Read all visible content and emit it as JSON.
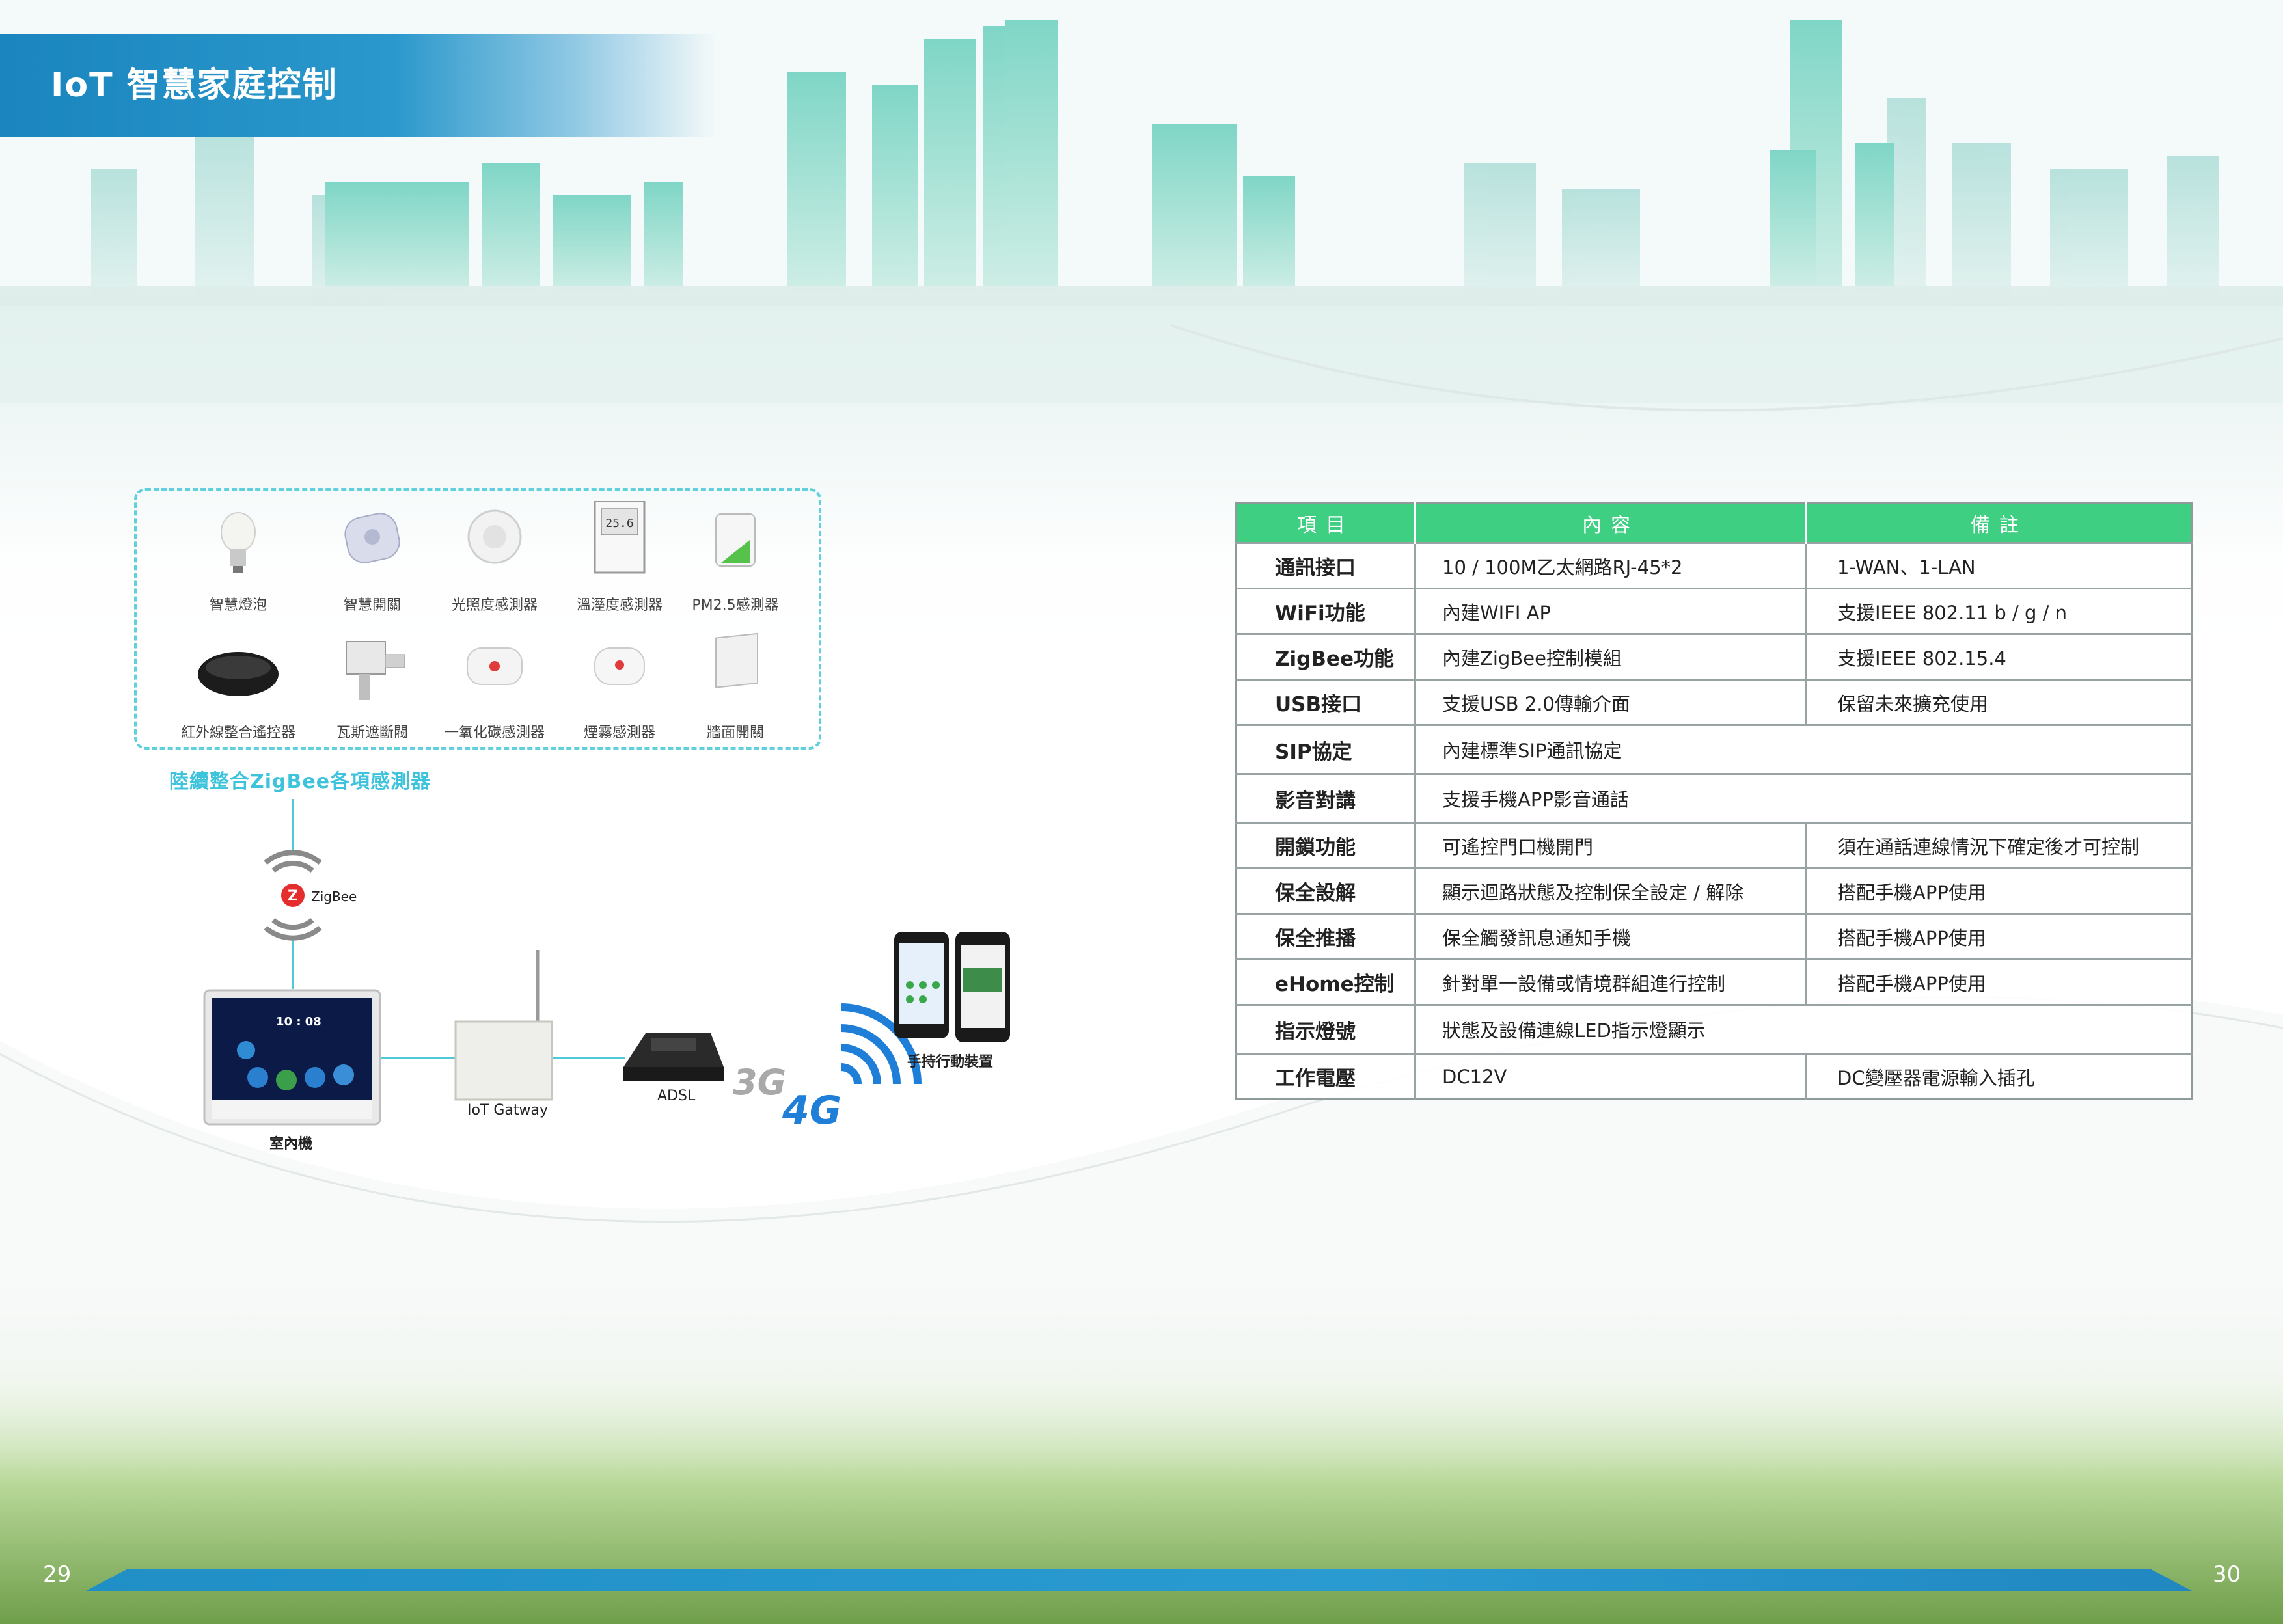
{
  "header": {
    "title": "IoT 智慧家庭控制"
  },
  "sensors": {
    "items": [
      {
        "label": "智慧燈泡",
        "icon": "smart-bulb-icon"
      },
      {
        "label": "智慧開關",
        "icon": "smart-switch-icon"
      },
      {
        "label": "光照度感測器",
        "icon": "light-sensor-icon"
      },
      {
        "label": "溫溼度感測器",
        "icon": "thermo-hygrometer-icon"
      },
      {
        "label": "PM2.5感測器",
        "icon": "pm25-sensor-icon"
      },
      {
        "label": "紅外線整合遙控器",
        "icon": "ir-remote-icon"
      },
      {
        "label": "瓦斯遮斷閥",
        "icon": "gas-valve-icon"
      },
      {
        "label": "一氧化碳感測器",
        "icon": "co-sensor-icon"
      },
      {
        "label": "煙霧感測器",
        "icon": "smoke-sensor-icon"
      },
      {
        "label": "牆面開關",
        "icon": "wall-switch-icon"
      }
    ],
    "caption": "陸續整合ZigBee各項感測器"
  },
  "diagram": {
    "zigbee": "ZigBee",
    "indoor_time": "10 : 08",
    "indoor_unit": "室內機",
    "gateway": "IoT Gatway",
    "adsl": "ADSL",
    "g3": "3G",
    "g4": "4G",
    "mobile": "手持行動裝置"
  },
  "spec_table": {
    "headers": [
      "項目",
      "內容",
      "備註"
    ],
    "rows": [
      {
        "item": "通訊接口",
        "content": "10 / 100M乙太網路RJ-45*2",
        "note": "1-WAN、1-LAN"
      },
      {
        "item": "WiFi功能",
        "content": "內建WIFI AP",
        "note": "支援IEEE 802.11 b / g / n"
      },
      {
        "item": "ZigBee功能",
        "content": "內建ZigBee控制模組",
        "note": "支援IEEE 802.15.4"
      },
      {
        "item": "USB接口",
        "content": "支援USB 2.0傳輸介面",
        "note": "保留未來擴充使用"
      },
      {
        "item": "SIP協定",
        "content": "內建標準SIP通訊協定",
        "note": ""
      },
      {
        "item": "影音對講",
        "content": "支援手機APP影音通話",
        "note": ""
      },
      {
        "item": "開鎖功能",
        "content": "可遙控門口機開門",
        "note": "須在通話連線情況下確定後才可控制"
      },
      {
        "item": "保全設解",
        "content": "顯示迴路狀態及控制保全設定 / 解除",
        "note": "搭配手機APP使用"
      },
      {
        "item": "保全推播",
        "content": "保全觸發訊息通知手機",
        "note": "搭配手機APP使用"
      },
      {
        "item": "eHome控制",
        "content": "針對單一設備或情境群組進行控制",
        "note": "搭配手機APP使用"
      },
      {
        "item": "指示燈號",
        "content": "狀態及設備連線LED指示燈顯示",
        "note": ""
      },
      {
        "item": "工作電壓",
        "content": "DC12V",
        "note": "DC變壓器電源輸入插孔"
      }
    ]
  },
  "footer": {
    "page_left": "29",
    "page_right": "30"
  },
  "colors": {
    "title_band": "#1a85be",
    "table_header": "#3ecf83",
    "sensor_border": "#5fd0dc",
    "caption": "#3ec3dc"
  }
}
